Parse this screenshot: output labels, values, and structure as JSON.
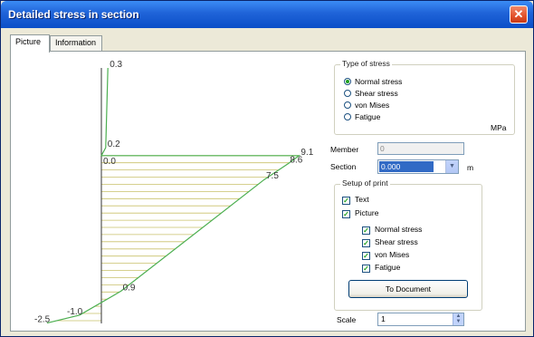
{
  "window": {
    "title": "Detailed stress in section",
    "close_glyph": "✕"
  },
  "tabs": [
    {
      "label": "Picture"
    },
    {
      "label": "Information"
    }
  ],
  "chart_data": {
    "type": "line",
    "polyline_points": [
      {
        "x": 0.3,
        "y": 0,
        "label": "0.3"
      },
      {
        "x": 0.2,
        "y": 1,
        "label": "0.2"
      },
      {
        "x": 0.0,
        "y": 1.1,
        "label": "0.0"
      },
      {
        "x": 9.1,
        "y": 1.1,
        "label": "9.1"
      },
      {
        "x": 8.6,
        "y": 1.2,
        "label": "8.6"
      },
      {
        "x": 7.5,
        "y": 1.4,
        "label": "7.5"
      },
      {
        "x": 0.9,
        "y": 2.8,
        "label": "0.9"
      },
      {
        "x": -1.0,
        "y": 3.1,
        "label": "-1.0"
      },
      {
        "x": -2.5,
        "y": 3.2,
        "label": "-2.5"
      }
    ]
  },
  "type_of_stress": {
    "title": "Type of stress",
    "options": [
      {
        "label": "Normal stress",
        "checked": true
      },
      {
        "label": "Shear stress",
        "checked": false
      },
      {
        "label": "von Mises",
        "checked": false
      },
      {
        "label": "Fatigue",
        "checked": false
      }
    ],
    "unit": "MPa"
  },
  "member": {
    "label": "Member",
    "value": "0"
  },
  "section": {
    "label": "Section",
    "value": "0.000",
    "unit": "m",
    "arrow": "▼"
  },
  "setup": {
    "title": "Setup of print",
    "text_label": "Text",
    "picture_label": "Picture",
    "sub_items": [
      {
        "label": "Normal stress"
      },
      {
        "label": "Shear stress"
      },
      {
        "label": "von Mises"
      },
      {
        "label": "Fatigue"
      }
    ],
    "check_glyph": "✓",
    "to_document_label": "To Document"
  },
  "scale": {
    "label": "Scale",
    "value": "1",
    "up": "▲",
    "down": "▼"
  }
}
